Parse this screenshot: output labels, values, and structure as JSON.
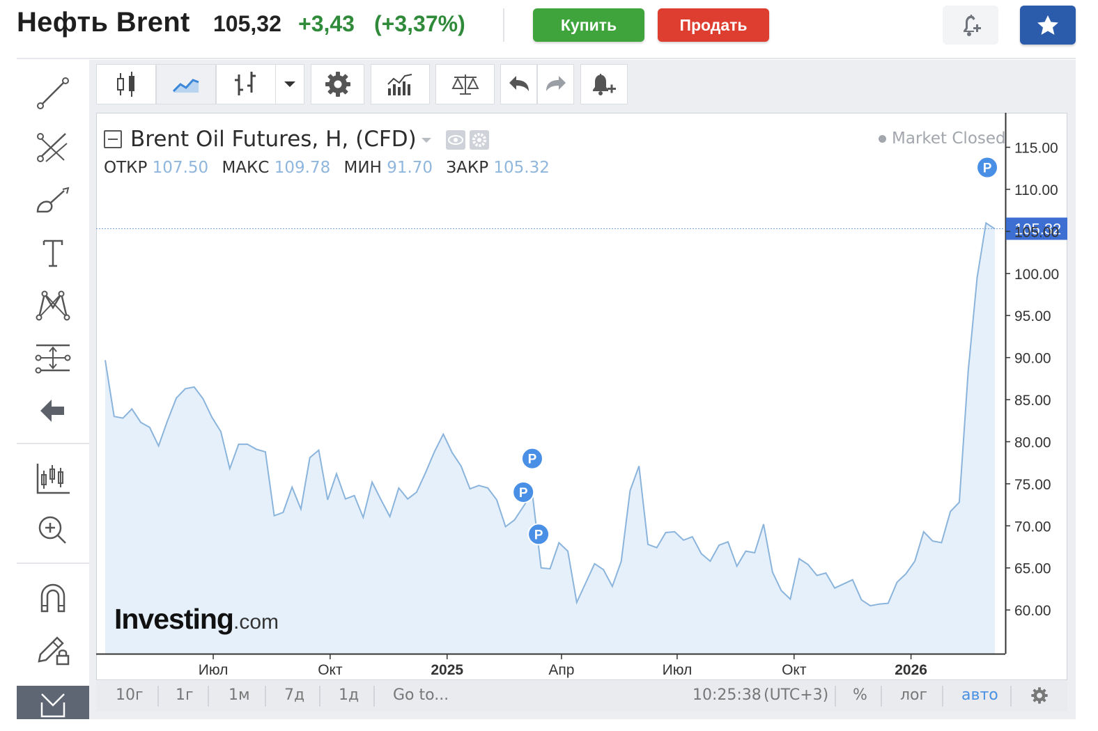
{
  "header": {
    "title": "Нефть Brent",
    "price": "105,32",
    "change": "+3,43",
    "change_percent": "(+3,37%)",
    "buy_label": "Купить",
    "sell_label": "Продать",
    "alert_icon": "bell-plus-icon",
    "favorite_icon": "star-icon"
  },
  "colors": {
    "buy": "#3ea43b",
    "sell": "#de3e2f",
    "positive": "#2f8a3a",
    "line": "#8ab4dc",
    "area": "#e6f0fa",
    "price_label": "#3c6fd1",
    "favorite": "#2b5cab"
  },
  "left_toolbar": {
    "tools": [
      "trend-line-icon",
      "fib-icon",
      "brush-icon",
      "text-icon",
      "pattern-icon",
      "measure-icon",
      "back-arrow-icon",
      "indicators-icon",
      "zoom-in-icon",
      "magnet-icon",
      "lock-drawing-icon",
      "dock-icon"
    ]
  },
  "top_toolbar": {
    "buttons": [
      "candles-icon",
      "area-chart-icon",
      "bars-icon",
      "dropdown-icon",
      "settings-icon",
      "indicators-icon",
      "compare-icon",
      "undo-icon",
      "redo-icon",
      "add-alert-icon"
    ],
    "active": "area-chart-icon"
  },
  "legend": {
    "title": "Brent Oil Futures, H, (CFD)",
    "open_label": "ОТКР",
    "open_value": "107.50",
    "high_label": "МАКС",
    "high_value": "109.78",
    "low_label": "МИН",
    "low_value": "91.70",
    "close_label": "ЗАКР",
    "close_value": "105.32",
    "market_status": "Market Closed"
  },
  "watermark": {
    "brand": "Investing",
    "suffix": ".com"
  },
  "bottom_bar": {
    "ranges": [
      "10г",
      "1г",
      "1м",
      "7д",
      "1д"
    ],
    "goto": "Go to...",
    "time": "10:25:38",
    "tz": "(UTC+3)",
    "percent": "%",
    "log": "лог",
    "auto": "авто",
    "settings_icon": "gear-icon"
  },
  "chart_data": {
    "type": "area",
    "title": "Brent Oil Futures, H, (CFD)",
    "xlabel": "",
    "ylabel": "",
    "ylim": [
      54.8,
      119.1
    ],
    "grid": false,
    "y_ticks": [
      60,
      65,
      70,
      75,
      80,
      85,
      90,
      95,
      100,
      105,
      110,
      115
    ],
    "y_tick_labels": [
      "60.00",
      "65.00",
      "70.00",
      "75.00",
      "80.00",
      "85.00",
      "90.00",
      "95.00",
      "100.00",
      "105.00",
      "110.00",
      "115.00"
    ],
    "x_ticks": [
      {
        "label": "Июл",
        "date": "2024-07",
        "bold": false
      },
      {
        "label": "Окт",
        "date": "2024-10",
        "bold": false
      },
      {
        "label": "2025",
        "date": "2025-01",
        "bold": true
      },
      {
        "label": "Апр",
        "date": "2025-04",
        "bold": false
      },
      {
        "label": "Июл",
        "date": "2025-07",
        "bold": false
      },
      {
        "label": "Окт",
        "date": "2025-10",
        "bold": false
      },
      {
        "label": "2026",
        "date": "2026-01",
        "bold": true
      }
    ],
    "current_price": 105.32,
    "current_price_label": "105.32",
    "series": [
      {
        "values": [
          [
            "2024-04-07",
            89.7
          ],
          [
            "2024-04-14",
            83.0
          ],
          [
            "2024-04-21",
            82.8
          ],
          [
            "2024-04-28",
            83.9
          ],
          [
            "2024-05-05",
            82.3
          ],
          [
            "2024-05-12",
            81.7
          ],
          [
            "2024-05-19",
            79.5
          ],
          [
            "2024-05-26",
            82.5
          ],
          [
            "2024-06-02",
            85.2
          ],
          [
            "2024-06-09",
            86.3
          ],
          [
            "2024-06-16",
            86.5
          ],
          [
            "2024-06-23",
            85.1
          ],
          [
            "2024-06-30",
            82.9
          ],
          [
            "2024-07-07",
            81.2
          ],
          [
            "2024-07-14",
            76.8
          ],
          [
            "2024-07-21",
            79.7
          ],
          [
            "2024-07-28",
            79.7
          ],
          [
            "2024-08-04",
            79.1
          ],
          [
            "2024-08-11",
            78.8
          ],
          [
            "2024-08-18",
            71.2
          ],
          [
            "2024-08-25",
            71.6
          ],
          [
            "2024-09-01",
            74.6
          ],
          [
            "2024-09-08",
            72.0
          ],
          [
            "2024-09-15",
            78.1
          ],
          [
            "2024-09-22",
            79.0
          ],
          [
            "2024-09-29",
            73.1
          ],
          [
            "2024-10-06",
            76.2
          ],
          [
            "2024-10-13",
            73.2
          ],
          [
            "2024-10-20",
            73.6
          ],
          [
            "2024-10-27",
            71.0
          ],
          [
            "2024-11-03",
            75.2
          ],
          [
            "2024-11-10",
            73.1
          ],
          [
            "2024-11-17",
            71.1
          ],
          [
            "2024-11-24",
            74.5
          ],
          [
            "2024-12-01",
            73.2
          ],
          [
            "2024-12-08",
            74.0
          ],
          [
            "2024-12-15",
            76.3
          ],
          [
            "2024-12-22",
            78.8
          ],
          [
            "2024-12-29",
            80.9
          ],
          [
            "2025-01-05",
            78.7
          ],
          [
            "2025-01-12",
            77.1
          ],
          [
            "2025-01-19",
            74.4
          ],
          [
            "2025-01-26",
            74.8
          ],
          [
            "2025-02-02",
            74.5
          ],
          [
            "2025-02-09",
            73.1
          ],
          [
            "2025-02-16",
            69.9
          ],
          [
            "2025-02-23",
            70.7
          ],
          [
            "2025-03-02",
            72.3
          ],
          [
            "2025-03-09",
            73.9
          ],
          [
            "2025-03-16",
            65.0
          ],
          [
            "2025-03-23",
            64.9
          ],
          [
            "2025-03-30",
            68.0
          ],
          [
            "2025-04-06",
            67.0
          ],
          [
            "2025-04-13",
            60.9
          ],
          [
            "2025-04-20",
            63.2
          ],
          [
            "2025-04-27",
            65.5
          ],
          [
            "2025-05-04",
            64.8
          ],
          [
            "2025-05-11",
            62.8
          ],
          [
            "2025-05-18",
            65.8
          ],
          [
            "2025-05-25",
            74.2
          ],
          [
            "2025-06-01",
            77.1
          ],
          [
            "2025-06-08",
            67.8
          ],
          [
            "2025-06-15",
            67.4
          ],
          [
            "2025-06-22",
            69.2
          ],
          [
            "2025-06-29",
            69.3
          ],
          [
            "2025-07-06",
            68.3
          ],
          [
            "2025-07-13",
            68.7
          ],
          [
            "2025-07-20",
            66.7
          ],
          [
            "2025-07-27",
            65.8
          ],
          [
            "2025-08-03",
            67.7
          ],
          [
            "2025-08-10",
            68.1
          ],
          [
            "2025-08-17",
            65.2
          ],
          [
            "2025-08-24",
            67.0
          ],
          [
            "2025-08-31",
            66.8
          ],
          [
            "2025-09-07",
            70.2
          ],
          [
            "2025-09-14",
            64.5
          ],
          [
            "2025-09-21",
            62.3
          ],
          [
            "2025-09-28",
            61.3
          ],
          [
            "2025-10-05",
            66.1
          ],
          [
            "2025-10-12",
            65.4
          ],
          [
            "2025-10-19",
            64.1
          ],
          [
            "2025-10-26",
            64.4
          ],
          [
            "2025-11-02",
            62.6
          ],
          [
            "2025-11-09",
            63.1
          ],
          [
            "2025-11-16",
            63.6
          ],
          [
            "2025-11-23",
            61.2
          ],
          [
            "2025-11-30",
            60.5
          ],
          [
            "2025-12-07",
            60.7
          ],
          [
            "2025-12-14",
            60.8
          ],
          [
            "2025-12-21",
            63.3
          ],
          [
            "2025-12-28",
            64.3
          ],
          [
            "2026-01-04",
            65.8
          ],
          [
            "2026-01-11",
            69.3
          ],
          [
            "2026-01-18",
            68.2
          ],
          [
            "2026-01-25",
            68.0
          ],
          [
            "2026-02-01",
            71.7
          ],
          [
            "2026-02-08",
            72.8
          ],
          [
            "2026-02-15",
            88.4
          ],
          [
            "2026-02-22",
            99.5
          ],
          [
            "2026-03-01",
            106.0
          ],
          [
            "2026-03-08",
            105.3
          ]
        ]
      }
    ],
    "events": [
      {
        "label": "P",
        "date": "2025-03-09",
        "value": 78.0
      },
      {
        "label": "P",
        "date": "2025-03-02",
        "value": 74.0
      },
      {
        "label": "P",
        "date": "2025-03-14",
        "value": 69.0
      },
      {
        "label": "P",
        "date": "2026-03-02",
        "value": 112.6
      }
    ]
  }
}
